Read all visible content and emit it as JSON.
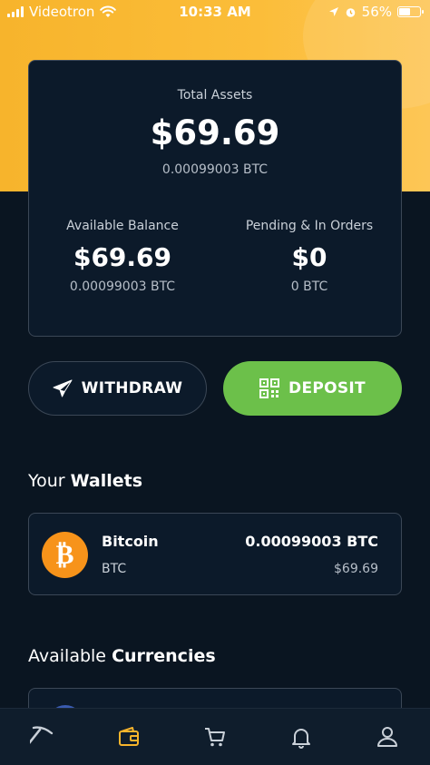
{
  "status_bar": {
    "carrier": "Videotron",
    "time": "10:33 AM",
    "battery_percent": "56%",
    "battery_level": 0.56
  },
  "assets": {
    "total_label": "Total Assets",
    "total_amount": "$69.69",
    "total_btc": "0.00099003 BTC",
    "available": {
      "label": "Available Balance",
      "amount": "$69.69",
      "btc": "0.00099003 BTC"
    },
    "pending": {
      "label": "Pending & In Orders",
      "amount": "$0",
      "btc": "0 BTC"
    }
  },
  "actions": {
    "withdraw_label": "WITHDRAW",
    "deposit_label": "DEPOSIT"
  },
  "wallets_section": {
    "title_prefix": "Your",
    "title_bold": "Wallets",
    "items": [
      {
        "name": "Bitcoin",
        "symbol": "BTC",
        "amount": "0.00099003 BTC",
        "value": "$69.69",
        "icon": "bitcoin-icon",
        "glyph": "₿"
      }
    ]
  },
  "currencies_section": {
    "title_prefix": "Available",
    "title_bold": "Currencies"
  },
  "tab_bar": {
    "tabs": [
      "pickaxe-icon",
      "wallet-icon",
      "cart-icon",
      "bell-icon",
      "profile-icon"
    ],
    "active": "wallet-icon"
  },
  "colors": {
    "accent_yellow": "#f7b42c",
    "deposit_green": "#6cc04a",
    "background": "#0a1521",
    "card": "#0c1a2a",
    "bitcoin_orange": "#f7931a"
  }
}
